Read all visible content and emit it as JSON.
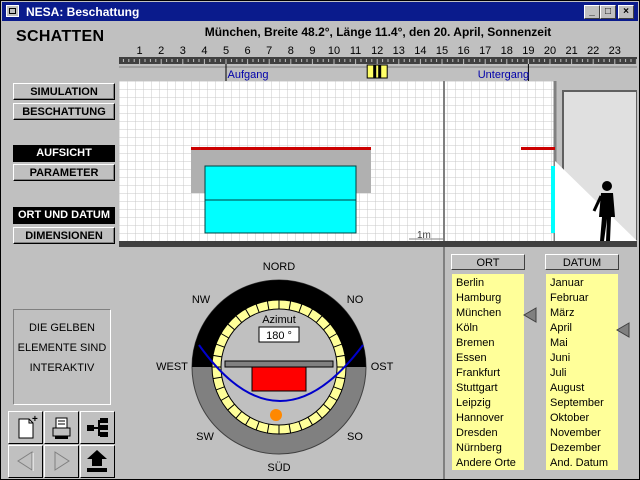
{
  "window": {
    "title": "NESA: Beschattung"
  },
  "sidebar": {
    "app_title": "SCHATTEN",
    "buttons": {
      "simulation": "SIMULATION",
      "beschattung": "BESCHATTUNG",
      "aufsicht": "AUFSICHT",
      "parameter": "PARAMETER",
      "ort_und_datum": "ORT UND DATUM",
      "dimensionen": "DIMENSIONEN"
    },
    "info_lines": [
      "DIE GELBEN",
      "ELEMENTE SIND",
      "INTERAKTIV"
    ]
  },
  "header": {
    "text": "München,  Breite 48.2°,  Länge 11.4°,  den 20. April,  Sonnenzeit"
  },
  "timeline": {
    "hours": [
      "1",
      "2",
      "3",
      "4",
      "5",
      "6",
      "7",
      "8",
      "9",
      "10",
      "11",
      "12",
      "13",
      "14",
      "15",
      "16",
      "17",
      "18",
      "19",
      "20",
      "21",
      "22",
      "23"
    ],
    "sunrise_label": "Aufgang",
    "sunset_label": "Untergang",
    "sunrise_hour": 5.0,
    "sunset_hour": 19.0,
    "current_hour": 12.0
  },
  "elevation": {
    "scale_label": "1m"
  },
  "compass": {
    "directions": {
      "n": "NORD",
      "ne": "NO",
      "e": "OST",
      "se": "SO",
      "s": "SÜD",
      "sw": "SW",
      "w": "WEST",
      "nw": "NW"
    },
    "azimuth_label": "Azimut",
    "azimuth_value": "180 °"
  },
  "lists": {
    "ort_header": "ORT",
    "datum_header": "DATUM",
    "ort": [
      "Berlin",
      "Hamburg",
      "München",
      "Köln",
      "Bremen",
      "Essen",
      "Frankfurt",
      "Stuttgart",
      "Leipzig",
      "Hannover",
      "Dresden",
      "Nürnberg",
      "Andere Orte"
    ],
    "datum": [
      "Januar",
      "Februar",
      "März",
      "April",
      "Mai",
      "Juni",
      "Juli",
      "August",
      "September",
      "Oktober",
      "November",
      "Dezember",
      "And. Datum"
    ]
  },
  "colors": {
    "titlebar": "#0a1b8c",
    "cyan": "#00ffff",
    "yellow": "#ffff99",
    "red_object": "#ff0000",
    "sun": "#ff8800",
    "sunpath": "#0000cc",
    "label_blue": "#0000aa"
  }
}
